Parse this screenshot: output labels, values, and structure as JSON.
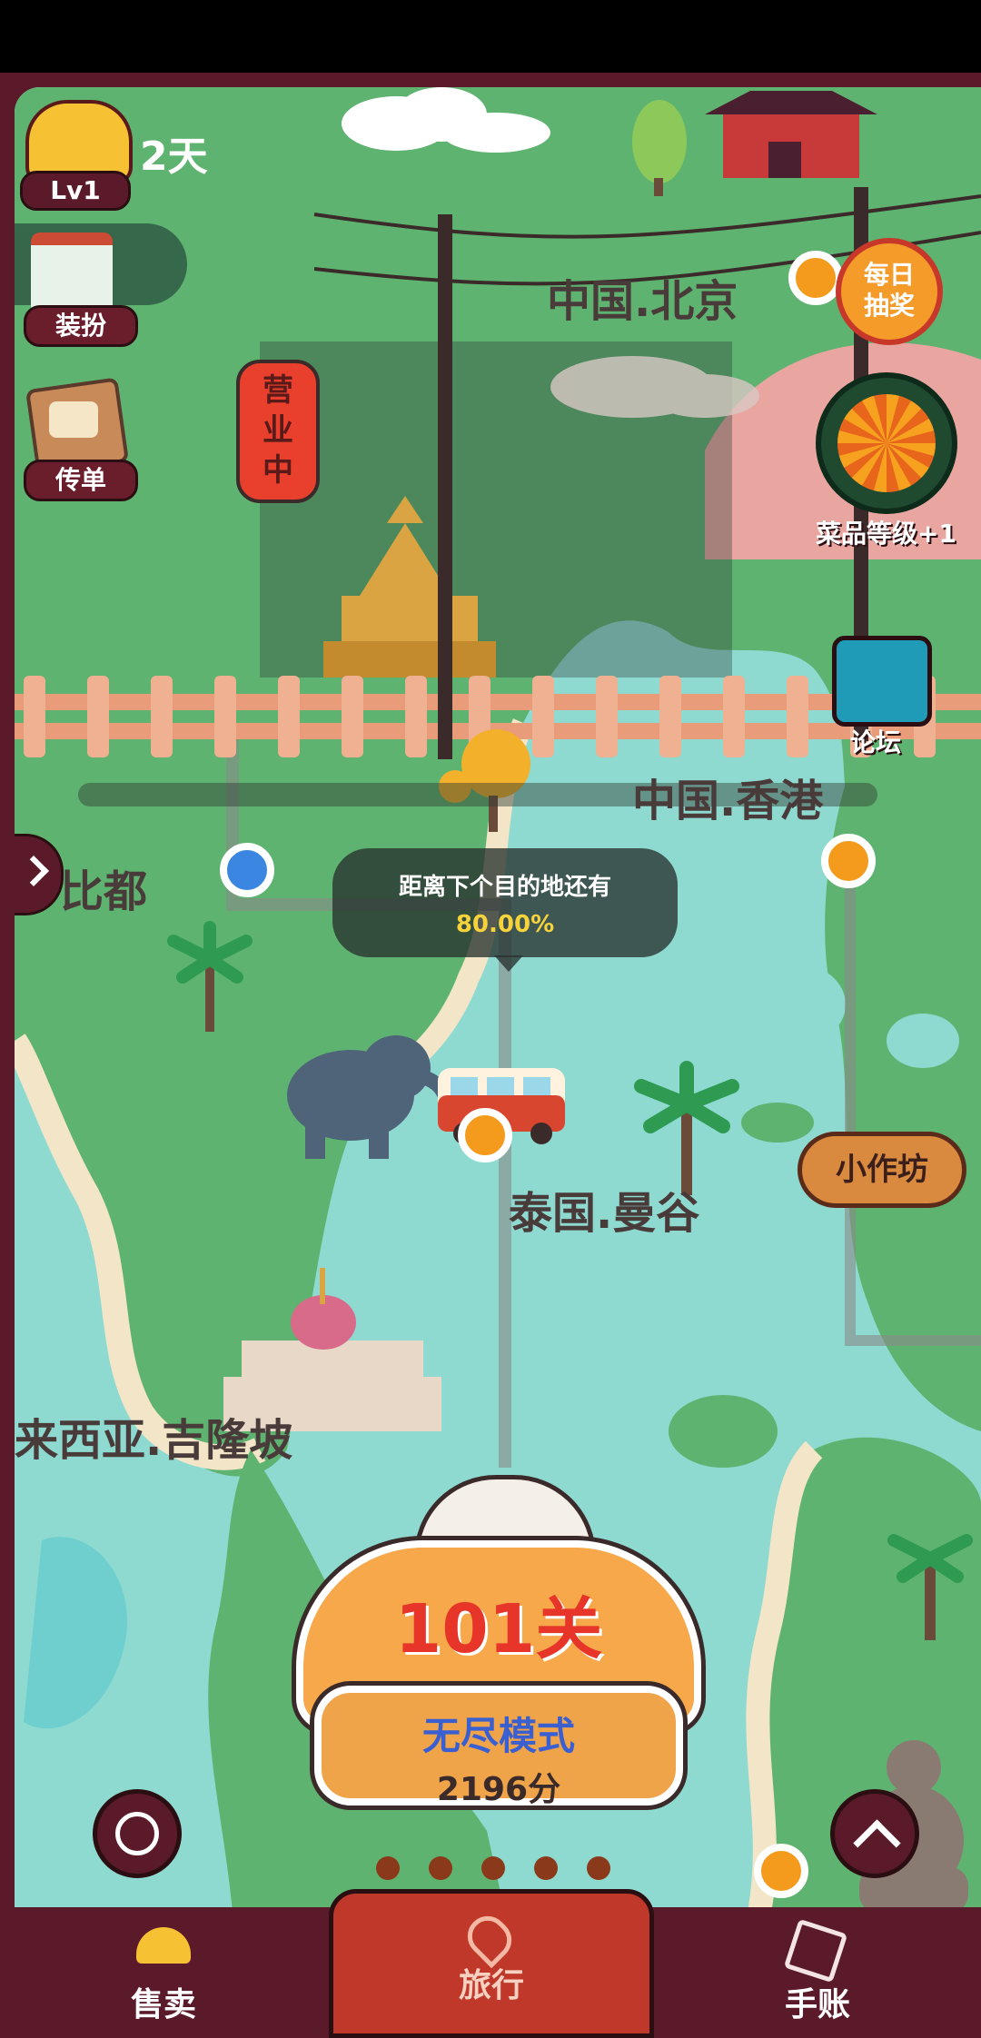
{
  "top_left": {
    "level_badge": "Lv1",
    "days_text": "2天"
  },
  "side_buttons": {
    "outfit": "装扮",
    "flyer": "传单"
  },
  "right_buttons": {
    "daily_draw": "每日\n抽奖",
    "dish_level": "菜品等级+1",
    "forum": "论坛",
    "workshop": "小作坊"
  },
  "lantern": "营业中",
  "places": {
    "beijing": "中国.北京",
    "hongkong": "中国.香港",
    "bangkok": "泰国.曼谷",
    "kualalumpur": "来西亚.吉隆坡",
    "west": "比都"
  },
  "progress": {
    "label": "距离下个目的地还有",
    "value_text": "80.00%",
    "value": 0.8
  },
  "stage_card": {
    "level_text": "101关",
    "endless_label": "无尽模式",
    "score_text": "2196分"
  },
  "bottom_nav": {
    "tabs": [
      {
        "label": "售卖",
        "icon": "bell-icon",
        "active": false
      },
      {
        "label": "旅行",
        "icon": "map-pin-icon",
        "active": true
      },
      {
        "label": "手账",
        "icon": "notebook-icon",
        "active": false
      }
    ]
  },
  "page_dots": 5,
  "colors": {
    "frame": "#5a1a2a",
    "land": "#5fb370",
    "sea": "#8fdad0",
    "active_tab": "#c0382a",
    "accent_orange": "#f49a1c"
  }
}
